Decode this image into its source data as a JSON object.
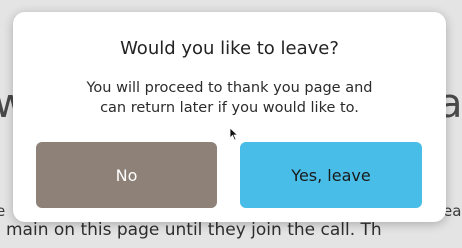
{
  "background": {
    "large_left": "w",
    "large_right": "a",
    "small_left": "e",
    "small_right": "ea",
    "bottom_line": "main on this page until they join the call. Th"
  },
  "dialog": {
    "title": "Would you like to leave?",
    "message_line1": "You will proceed to thank you page and",
    "message_line2": "can return later if you would like to.",
    "no_label": "No",
    "yes_label": "Yes, leave"
  },
  "colors": {
    "no_button": "#8e8178",
    "yes_button": "#47bde8",
    "dialog_bg": "#ffffff",
    "backdrop": "#e4e4e4"
  },
  "icons": {
    "cursor": "mouse-pointer-icon"
  }
}
